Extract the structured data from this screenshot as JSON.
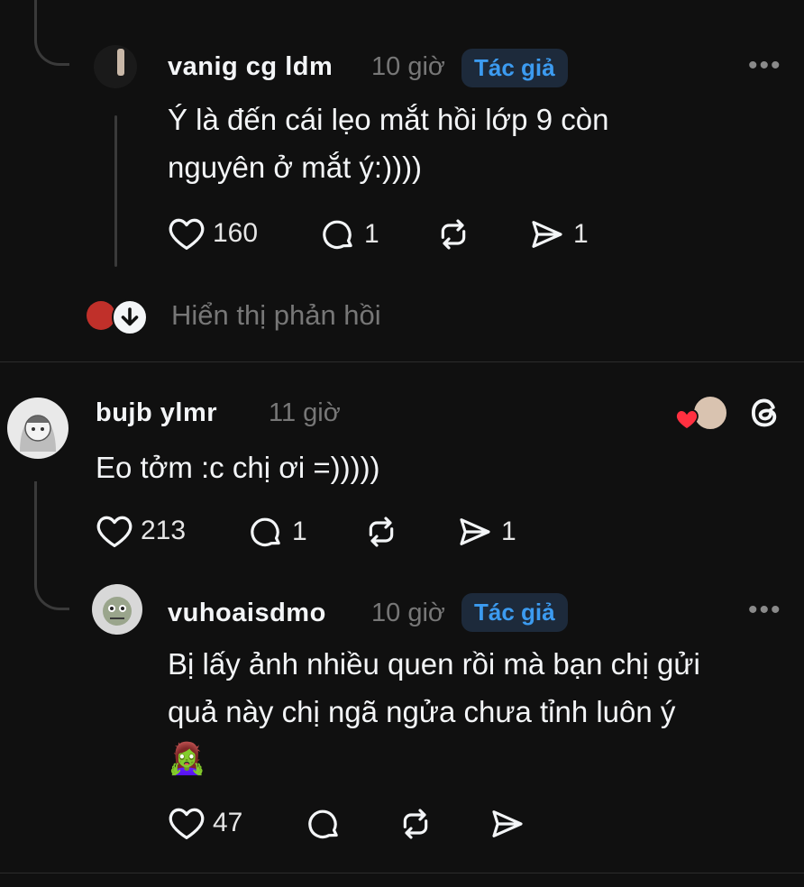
{
  "reply1": {
    "username": "vanig cg ldm",
    "time": "10 giờ",
    "badge": "Tác giả",
    "more": "•••",
    "text_line1": "Ý là đến cái lẹo mắt hồi lớp 9 còn",
    "text_line2": "nguyên ở mắt ý:))))",
    "likes": "160",
    "comments": "1",
    "shares": "1"
  },
  "show_replies": {
    "label": "Hiển thị phản hồi"
  },
  "comment2": {
    "username": "bujb ylmr",
    "time": "11 giờ",
    "text": "Eo tởm :c chị ơi =)))))",
    "likes": "213",
    "comments": "1",
    "shares": "1"
  },
  "reply2": {
    "username": "vuhoaisdmo",
    "time": "10 giờ",
    "badge": "Tác giả",
    "more": "•••",
    "text_line1": "Bị lấy ảnh nhiều quen rồi mà bạn chị gửi",
    "text_line2": "quả này chị ngã ngửa chưa tỉnh luôn ý",
    "emoji": "🧟‍♀️",
    "likes": "47"
  },
  "colors": {
    "background": "#101010",
    "badge_text": "#3c9bf0",
    "badge_bg": "#1d2a3b",
    "muted": "#777777",
    "heart_red": "#ff3040"
  },
  "icons": [
    "heart-icon",
    "comment-icon",
    "repost-icon",
    "share-icon",
    "threads-logo-icon",
    "arrow-down-icon",
    "more-icon"
  ]
}
